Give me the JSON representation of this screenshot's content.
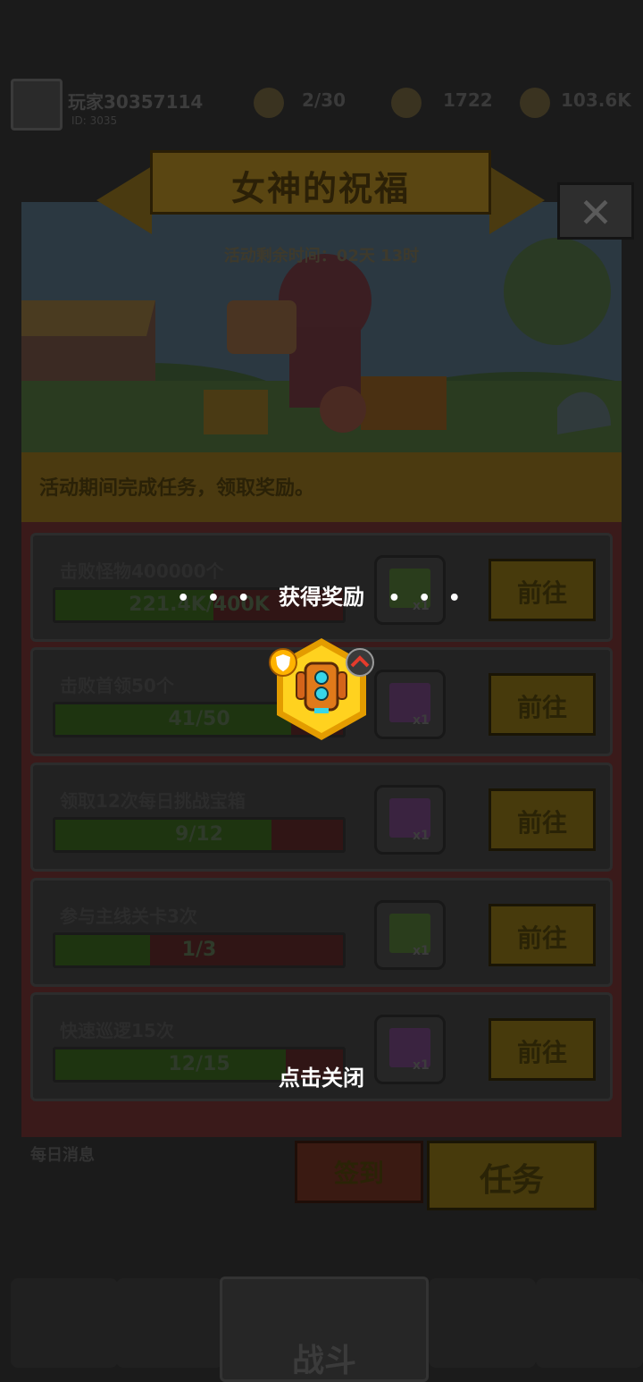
{
  "header": {
    "player_id": "玩家30357114",
    "player_sub": "ID: 3035",
    "stamina": "2/30",
    "gems": "1722",
    "coins": "103.6K"
  },
  "event": {
    "title": "女神的祝福",
    "close_icon": "close-icon",
    "timer": "活动剩余时间：02天 13时",
    "description": "活动期间完成任务，领取奖励。"
  },
  "tasks": [
    {
      "label": "击败怪物400000个",
      "progress_text": "221.4K/400K",
      "progress": 0.55,
      "reward_qty": "x1",
      "chest": "green",
      "button": "前往"
    },
    {
      "label": "击败首领50个",
      "progress_text": "41/50",
      "progress": 0.82,
      "reward_qty": "x1",
      "chest": "purple",
      "button": "前往"
    },
    {
      "label": "领取12次每日挑战宝箱",
      "progress_text": "9/12",
      "progress": 0.75,
      "reward_qty": "x1",
      "chest": "purple",
      "button": "前往"
    },
    {
      "label": "参与主线关卡3次",
      "progress_text": "1/3",
      "progress": 0.33,
      "reward_qty": "x1",
      "chest": "green",
      "button": "前往"
    },
    {
      "label": "快速巡逻15次",
      "progress_text": "12/15",
      "progress": 0.8,
      "reward_qty": "x1",
      "chest": "purple",
      "button": "前往"
    }
  ],
  "tabs": {
    "signin": "签到",
    "task": "任务",
    "left_hint": "每日消息"
  },
  "reward_popup": {
    "title": "获得奖励",
    "dots": "• • •",
    "item_icon": "robot-gear-icon",
    "close_hint": "点击关闭"
  },
  "bottom_nav": {
    "center_label": "战斗"
  },
  "colors": {
    "hex_gold": "#f5b800",
    "hex_inner": "#ffd21f",
    "chest_green": "#2a3d1c",
    "chest_purple": "#3a2340"
  }
}
